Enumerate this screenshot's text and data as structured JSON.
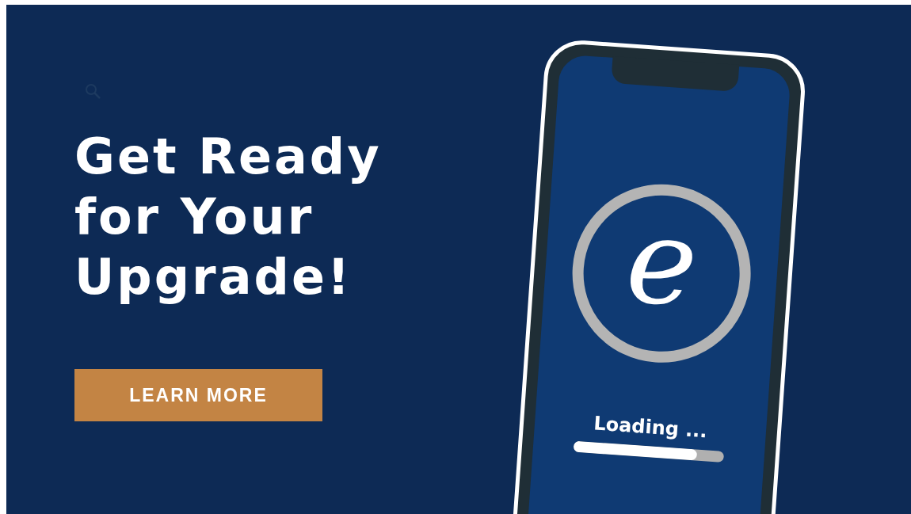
{
  "headline": [
    "Get Ready",
    "for Your",
    "Upgrade!"
  ],
  "button": {
    "label": "LEARN MORE"
  },
  "phone": {
    "logo": "e",
    "loading_text": "Loading ...",
    "progress": {
      "level": 0.82
    }
  }
}
